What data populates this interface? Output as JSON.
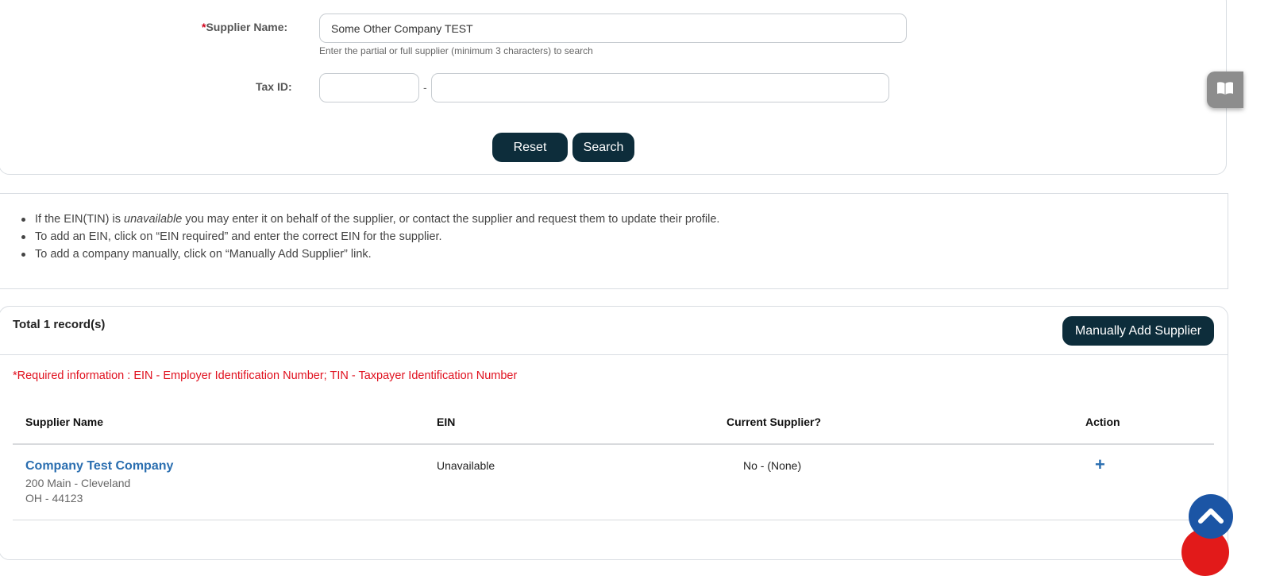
{
  "search": {
    "supplier_label_star": "*",
    "supplier_label": "Supplier Name:",
    "supplier_value": "Some Other Company TEST",
    "supplier_hint": "Enter the partial or full supplier (minimum 3 characters) to search",
    "tax_label": "Tax ID:",
    "tax_separator": "-",
    "tax_part1_value": "",
    "tax_part2_value": "",
    "reset_label": "Reset",
    "search_label": "Search"
  },
  "info": {
    "line1_prefix": "If the EIN(TIN) is ",
    "line1_emphasis": "unavailable",
    "line1_suffix": " you may enter it on behalf of the supplier, or contact the supplier and request them to update their profile.",
    "line2": "To add an EIN, click on “EIN required” and enter the correct EIN for the supplier.",
    "line3": "To add a company manually, click on “Manually Add Supplier” link."
  },
  "results": {
    "total": "Total 1 record(s)",
    "manual_add_label": "Manually Add Supplier",
    "required_info": "*Required information : EIN - Employer Identification Number; TIN - Taxpayer Identification Number",
    "columns": [
      "Supplier Name",
      "EIN",
      "Current Supplier?",
      "Action"
    ],
    "rows": [
      {
        "name": "Company Test Company",
        "address_line1": "200 Main - Cleveland",
        "address_line2": "OH - 44123",
        "ein": "Unavailable",
        "current_supplier": "No - (None)",
        "action_icon": "plus-icon"
      }
    ]
  },
  "icons": {
    "side_tab": "book-icon",
    "scroll_top": "chevron-up-icon"
  },
  "colors": {
    "button_bg": "#0d2d3b",
    "link": "#2a6eb0",
    "required": "#e0101e",
    "scroll_top_bg": "#1b55a5"
  }
}
